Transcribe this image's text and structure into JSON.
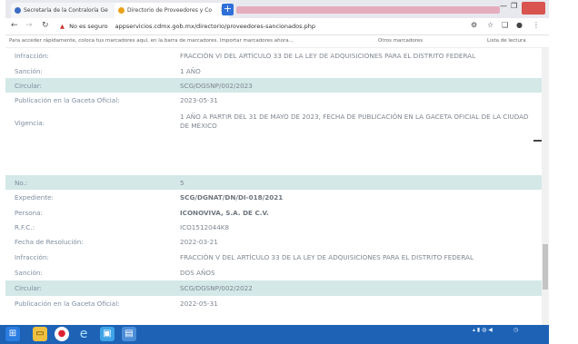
{
  "browser": {
    "tabs": [
      {
        "label": "Secretaría de la Contraloría Ge"
      },
      {
        "label": "Directorio de Proveedores y Co"
      }
    ],
    "address": {
      "security_label": "No es seguro",
      "url": "appservicios.cdmx.gob.mx/directorio/proveedores-sancionados.php"
    },
    "bookmarks": [
      "Para acceder rápidamente, coloca tus marcadores aquí, en la barra de marcadores. Importar marcadores ahora...",
      "Otros marcadores",
      "Lista de lectura"
    ]
  },
  "records": [
    {
      "label": "Infracción:",
      "value": "FRACCIÓN VI DEL ARTÍCULO 33 DE LA LEY DE ADQUISICIONES PARA EL DISTRITO FEDERAL"
    },
    {
      "label": "Sanción:",
      "value": "1 AÑO"
    },
    {
      "label": "Circular:",
      "value": "SCG/DGSNP/002/2023"
    },
    {
      "label": "Publicación en la Gaceta Oficial:",
      "value": "2023-05-31"
    },
    {
      "label": "Vigencia:",
      "value": "1 AÑO A PARTIR DEL 31 DE MAYO DE 2023, FECHA DE PUBLICACIÓN EN LA GACETA OFICIAL DE LA CIUDAD DE MÉXICO"
    },
    {
      "label": "No.:",
      "value": "5"
    },
    {
      "label": "Expediente:",
      "value": "SCG/DGNAT/DN/DI-018/2021"
    },
    {
      "label": "Persona:",
      "value": "ICONOVIVA, S.A. DE C.V."
    },
    {
      "label": "R.F.C.:",
      "value": "ICO1512044K8"
    },
    {
      "label": "Fecha de Resolución:",
      "value": "2022-03-21"
    },
    {
      "label": "Infracción:",
      "value": "FRACCIÓN V DEL ARTÍCULO 33 DE LA LEY DE ADQUISICIONES PARA EL DISTRITO FEDERAL"
    },
    {
      "label": "Sanción:",
      "value": "DOS AÑOS"
    },
    {
      "label": "Circular:",
      "value": "SCG/DGSNP/002/2022"
    },
    {
      "label": "Publicación en la Gaceta Oficial:",
      "value": "2022-05-31"
    }
  ]
}
